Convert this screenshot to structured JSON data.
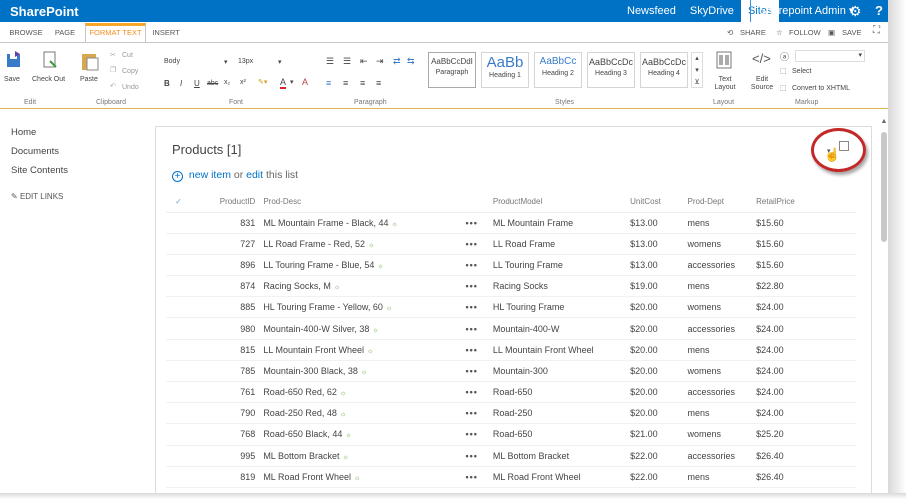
{
  "suitebar": {
    "brand": "SharePoint",
    "links": [
      "Newsfeed",
      "SkyDrive",
      "Sites"
    ],
    "active_link": "Sites",
    "user": "Sharepoint Admin ▾",
    "settings_icon": "gear-icon",
    "help_label": "?"
  },
  "ribbon_tabs": {
    "tabs": [
      "BROWSE",
      "PAGE",
      "FORMAT TEXT",
      "INSERT"
    ],
    "selected": "FORMAT TEXT",
    "share": "SHARE",
    "follow": "FOLLOW",
    "save": "SAVE"
  },
  "ribbon": {
    "edit": {
      "save": "Save",
      "checkout": "Check Out",
      "group": "Edit"
    },
    "clipboard": {
      "paste": "Paste",
      "cut": "Cut",
      "copy": "Copy",
      "undo": "Undo",
      "group": "Clipboard"
    },
    "font": {
      "family": "Body",
      "size": "13px",
      "bold": "B",
      "italic": "I",
      "underline": "U",
      "strike": "abc",
      "sub": "x₂",
      "sup": "x²",
      "font_color": "A",
      "clear": "A",
      "group": "Font"
    },
    "paragraph": {
      "group": "Paragraph"
    },
    "styles": {
      "items": [
        {
          "sample": "AaBbCcDdI",
          "name": "Paragraph"
        },
        {
          "sample": "AaBb",
          "name": "Heading 1"
        },
        {
          "sample": "AaBbCc",
          "name": "Heading 2"
        },
        {
          "sample": "AaBbCcDc",
          "name": "Heading 3"
        },
        {
          "sample": "AaBbCcDc",
          "name": "Heading 4"
        }
      ],
      "group": "Styles"
    },
    "layout": {
      "text_layout": "Text Layout",
      "group": "Layout"
    },
    "markup": {
      "edit_source": "Edit Source",
      "select": "Select",
      "convert": "Convert to XHTML",
      "group": "Markup"
    }
  },
  "leftnav": {
    "items": [
      "Home",
      "Documents",
      "Site Contents"
    ],
    "edit_links": "EDIT LINKS"
  },
  "webpart": {
    "title": "Products [1]",
    "new_item": "new item",
    "or": "or",
    "edit_list": "edit",
    "this_list": "this list"
  },
  "table": {
    "columns": [
      "✓",
      "ProductID",
      "Prod-Desc",
      "",
      "ProductModel",
      "UnitCost",
      "Prod-Dept",
      "RetailPrice"
    ],
    "rows": [
      {
        "id": "831",
        "desc": "ML Mountain Frame - Black, 44",
        "model": "ML Mountain Frame",
        "cost": "$13.00",
        "dept": "mens",
        "price": "$15.60"
      },
      {
        "id": "727",
        "desc": "LL Road Frame - Red, 52",
        "model": "LL Road Frame",
        "cost": "$13.00",
        "dept": "womens",
        "price": "$15.60"
      },
      {
        "id": "896",
        "desc": "LL Touring Frame - Blue, 54",
        "model": "LL Touring Frame",
        "cost": "$13.00",
        "dept": "accessories",
        "price": "$15.60"
      },
      {
        "id": "874",
        "desc": "Racing Socks, M",
        "model": "Racing Socks",
        "cost": "$19.00",
        "dept": "mens",
        "price": "$22.80"
      },
      {
        "id": "885",
        "desc": "HL Touring Frame - Yellow, 60",
        "model": "HL Touring Frame",
        "cost": "$20.00",
        "dept": "womens",
        "price": "$24.00"
      },
      {
        "id": "980",
        "desc": "Mountain-400-W Silver, 38",
        "model": "Mountain-400-W",
        "cost": "$20.00",
        "dept": "accessories",
        "price": "$24.00"
      },
      {
        "id": "815",
        "desc": "LL Mountain Front Wheel",
        "model": "LL Mountain Front Wheel",
        "cost": "$20.00",
        "dept": "mens",
        "price": "$24.00"
      },
      {
        "id": "785",
        "desc": "Mountain-300 Black, 38",
        "model": "Mountain-300",
        "cost": "$20.00",
        "dept": "womens",
        "price": "$24.00"
      },
      {
        "id": "761",
        "desc": "Road-650 Red, 62",
        "model": "Road-650",
        "cost": "$20.00",
        "dept": "accessories",
        "price": "$24.00"
      },
      {
        "id": "790",
        "desc": "Road-250 Red, 48",
        "model": "Road-250",
        "cost": "$20.00",
        "dept": "mens",
        "price": "$24.00"
      },
      {
        "id": "768",
        "desc": "Road-650 Black, 44",
        "model": "Road-650",
        "cost": "$21.00",
        "dept": "womens",
        "price": "$25.20"
      },
      {
        "id": "995",
        "desc": "ML Bottom Bracket",
        "model": "ML Bottom Bracket",
        "cost": "$22.00",
        "dept": "accessories",
        "price": "$26.40"
      },
      {
        "id": "819",
        "desc": "ML Road Front Wheel",
        "model": "ML Road Front Wheel",
        "cost": "$22.00",
        "dept": "mens",
        "price": "$26.40"
      }
    ],
    "new_marker": "☼",
    "ellipsis": "•••"
  },
  "colors": {
    "suitebar": "#0072c6",
    "accent_tab": "#f8a628",
    "link": "#0072c6",
    "highlight_circle": "#c22a29"
  }
}
